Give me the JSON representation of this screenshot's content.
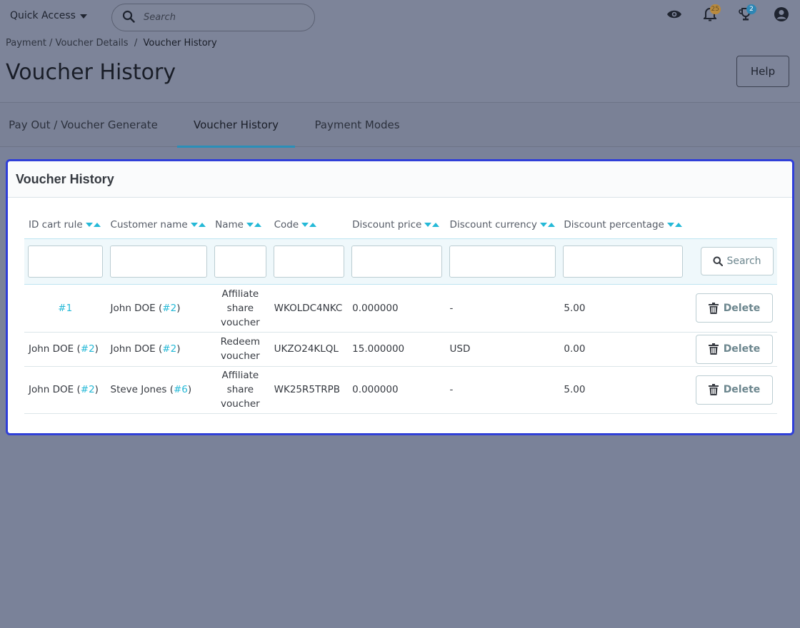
{
  "topbar": {
    "quick_access_label": "Quick Access",
    "search_placeholder": "Search",
    "notifications_count": "25",
    "orders_count": "2"
  },
  "breadcrumb": {
    "parent": "Payment / Voucher Details",
    "separator": "/",
    "current": "Voucher History"
  },
  "page_title": "Voucher History",
  "help_label": "Help",
  "tabs": [
    {
      "label": "Pay Out / Voucher Generate"
    },
    {
      "label": "Voucher History"
    },
    {
      "label": "Payment Modes"
    }
  ],
  "panel": {
    "title": "Voucher History",
    "columns": [
      "ID cart rule",
      "Customer name",
      "Name",
      "Code",
      "Discount price",
      "Discount currency",
      "Discount percentage"
    ],
    "search_label": "Search",
    "delete_label": "Delete",
    "rows": [
      {
        "id_text": "#1",
        "id_is_link": true,
        "customer_name": "John DOE",
        "customer_ref": "#2",
        "name_lines": [
          "Affiliate",
          "share",
          "voucher"
        ],
        "code": "WKOLDC4NKC",
        "discount_price": "0.000000",
        "discount_currency": "-",
        "discount_percentage": "5.00"
      },
      {
        "id_text": "John DOE",
        "id_ref": "#2",
        "customer_name": "John DOE",
        "customer_ref": "#2",
        "name_lines": [
          "Redeem",
          "voucher"
        ],
        "code": "UKZO24KLQL",
        "discount_price": "15.000000",
        "discount_currency": "USD",
        "discount_percentage": "0.00"
      },
      {
        "id_text": "John DOE",
        "id_ref": "#2",
        "customer_name": "Steve Jones",
        "customer_ref": "#6",
        "name_lines": [
          "Affiliate",
          "share",
          "voucher"
        ],
        "code": "WK25R5TRPB",
        "discount_price": "0.000000",
        "discount_currency": "-",
        "discount_percentage": "5.00"
      }
    ]
  },
  "colors": {
    "accent": "#25b9d7",
    "panel_border": "#2f3fd8",
    "tab_underline": "#2a8fb8",
    "backdrop": "#7a8299"
  }
}
